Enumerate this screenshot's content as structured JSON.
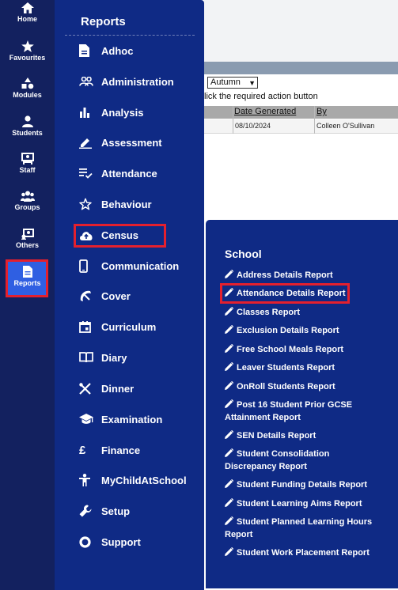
{
  "background": {
    "term_select": "Autumn",
    "instruction": "lick the required action button",
    "columns": [
      "Date Generated",
      "By"
    ],
    "row": {
      "date": "08/10/2024",
      "by": "Colleen O'Sullivan"
    }
  },
  "rail": {
    "items": [
      {
        "label": "Home",
        "icon": "home-icon"
      },
      {
        "label": "Favourites",
        "icon": "star-icon"
      },
      {
        "label": "Modules",
        "icon": "modules-icon"
      },
      {
        "label": "Students",
        "icon": "student-icon"
      },
      {
        "label": "Staff",
        "icon": "staff-icon"
      },
      {
        "label": "Groups",
        "icon": "groups-icon"
      },
      {
        "label": "Others",
        "icon": "others-icon"
      },
      {
        "label": "Reports",
        "icon": "report-icon"
      }
    ]
  },
  "menu": {
    "title": "Reports",
    "items": [
      {
        "label": "Adhoc",
        "icon": "document-icon"
      },
      {
        "label": "Administration",
        "icon": "people-icon"
      },
      {
        "label": "Analysis",
        "icon": "bar-chart-icon"
      },
      {
        "label": "Assessment",
        "icon": "pencil-icon"
      },
      {
        "label": "Attendance",
        "icon": "checklist-icon"
      },
      {
        "label": "Behaviour",
        "icon": "star-outline-icon"
      },
      {
        "label": "Census",
        "icon": "cloud-upload-icon"
      },
      {
        "label": "Communication",
        "icon": "phone-icon"
      },
      {
        "label": "Cover",
        "icon": "cover-icon"
      },
      {
        "label": "Curriculum",
        "icon": "calendar-icon"
      },
      {
        "label": "Diary",
        "icon": "book-icon"
      },
      {
        "label": "Dinner",
        "icon": "cutlery-icon"
      },
      {
        "label": "Examination",
        "icon": "graduation-cap-icon"
      },
      {
        "label": "Finance",
        "icon": "pound-icon"
      },
      {
        "label": "MyChildAtSchool",
        "icon": "child-icon"
      },
      {
        "label": "Setup",
        "icon": "wrench-icon"
      },
      {
        "label": "Support",
        "icon": "support-ring-icon"
      }
    ]
  },
  "school": {
    "title": "School",
    "items": [
      "Address Details Report",
      "Attendance Details Report",
      "Classes Report",
      "Exclusion Details Report",
      "Free School Meals Report",
      "Leaver Students Report",
      "OnRoll Students Report",
      "Post 16 Student Prior GCSE Attainment Report",
      "SEN Details Report",
      "Student Consolidation Discrepancy Report",
      "Student Funding Details Report",
      "Student Learning Aims Report",
      "Student Planned Learning Hours Report",
      "Student Work Placement Report"
    ]
  },
  "colors": {
    "rail_bg": "#13215f",
    "menu_bg": "#0f2a85",
    "active_bg": "#2f5fe2",
    "highlight": "#e4202e"
  }
}
